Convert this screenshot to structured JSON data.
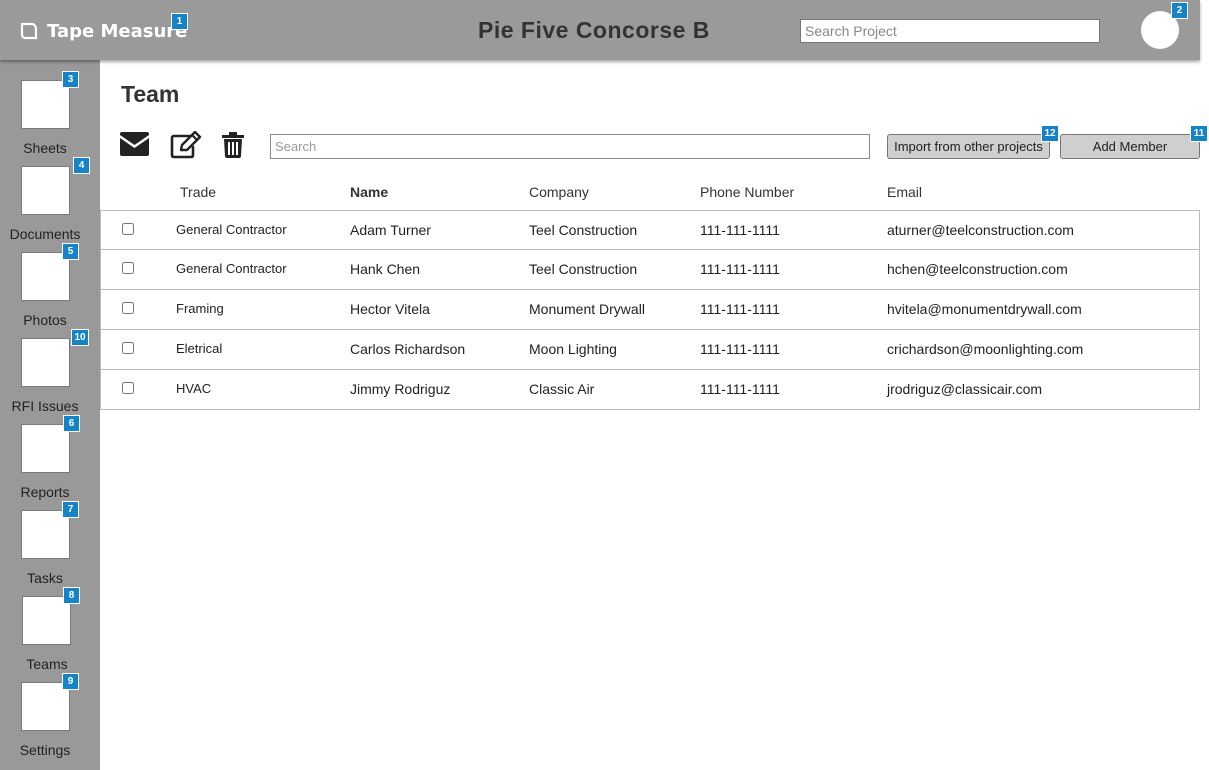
{
  "header": {
    "logo_text": "Tape Measure",
    "logo_badge": "1",
    "project_title": "Pie Five Concorse B",
    "search_placeholder": "Search Project",
    "avatar_badge": "2"
  },
  "sidebar": {
    "items": [
      {
        "label": "Sheets",
        "badge": "3"
      },
      {
        "label": "Documents",
        "badge": "4"
      },
      {
        "label": "Photos",
        "badge": "5"
      },
      {
        "label": "RFI Issues",
        "badge": "10"
      },
      {
        "label": "Reports",
        "badge": "6"
      },
      {
        "label": "Tasks",
        "badge": "7"
      },
      {
        "label": "Teams",
        "badge": "8"
      },
      {
        "label": "Settings",
        "badge": "9"
      }
    ]
  },
  "main": {
    "title": "Team",
    "toolbar": {
      "icons": [
        "envelope-icon",
        "edit-icon",
        "trash-icon"
      ],
      "search_placeholder": "Search",
      "import_label": "Import from other projects",
      "import_badge": "12",
      "add_label": "Add Member",
      "add_badge": "11"
    },
    "table": {
      "columns": [
        "Trade",
        "Name",
        "Company",
        "Phone Number",
        "Email"
      ],
      "rows": [
        {
          "trade": "General Contractor",
          "name": "Adam Turner",
          "company": "Teel Construction",
          "phone": "111-111-1111",
          "email": "aturner@teelconstruction.com"
        },
        {
          "trade": "General Contractor",
          "name": "Hank Chen",
          "company": "Teel Construction",
          "phone": "111-111-1111",
          "email": "hchen@teelconstruction.com"
        },
        {
          "trade": "Framing",
          "name": "Hector Vitela",
          "company": "Monument Drywall",
          "phone": "111-111-1111",
          "email": "hvitela@monumentdrywall.com"
        },
        {
          "trade": "Eletrical",
          "name": "Carlos Richardson",
          "company": "Moon Lighting",
          "phone": "111-111-1111",
          "email": "crichardson@moonlighting.com"
        },
        {
          "trade": "HVAC",
          "name": "Jimmy Rodriguz",
          "company": "Classic Air",
          "phone": "111-111-1111",
          "email": "jrodriguz@classicair.com"
        }
      ]
    }
  },
  "colors": {
    "chrome_gray": "#9a9a9a",
    "badge_blue": "#1583c8"
  }
}
